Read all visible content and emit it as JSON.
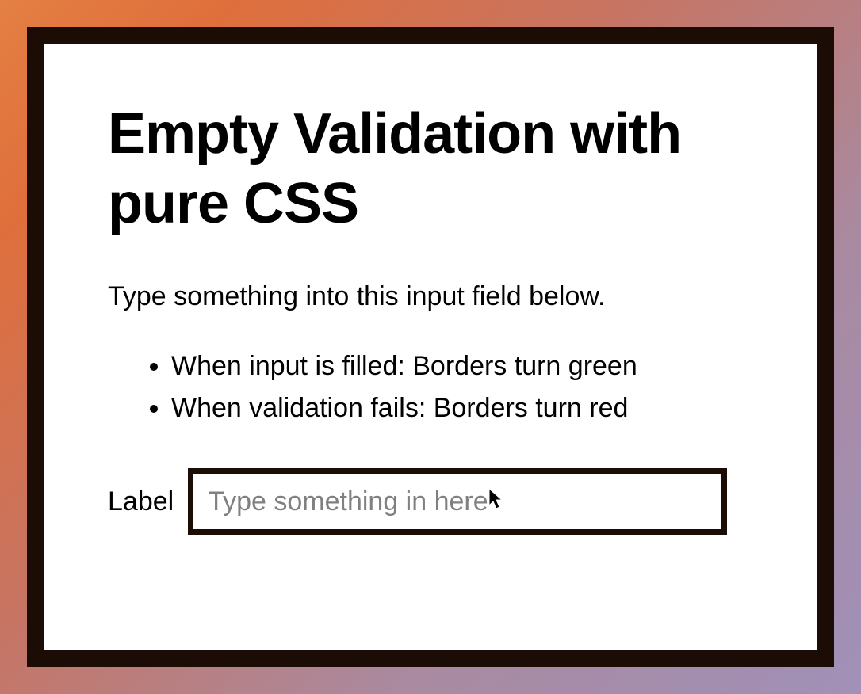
{
  "title": "Empty Validation with pure CSS",
  "description": "Type something into this input field below.",
  "bullets": [
    "When input is filled: Borders turn green",
    "When validation fails: Borders turn red"
  ],
  "form": {
    "label": "Label",
    "placeholder": "Type something in here",
    "value": ""
  }
}
